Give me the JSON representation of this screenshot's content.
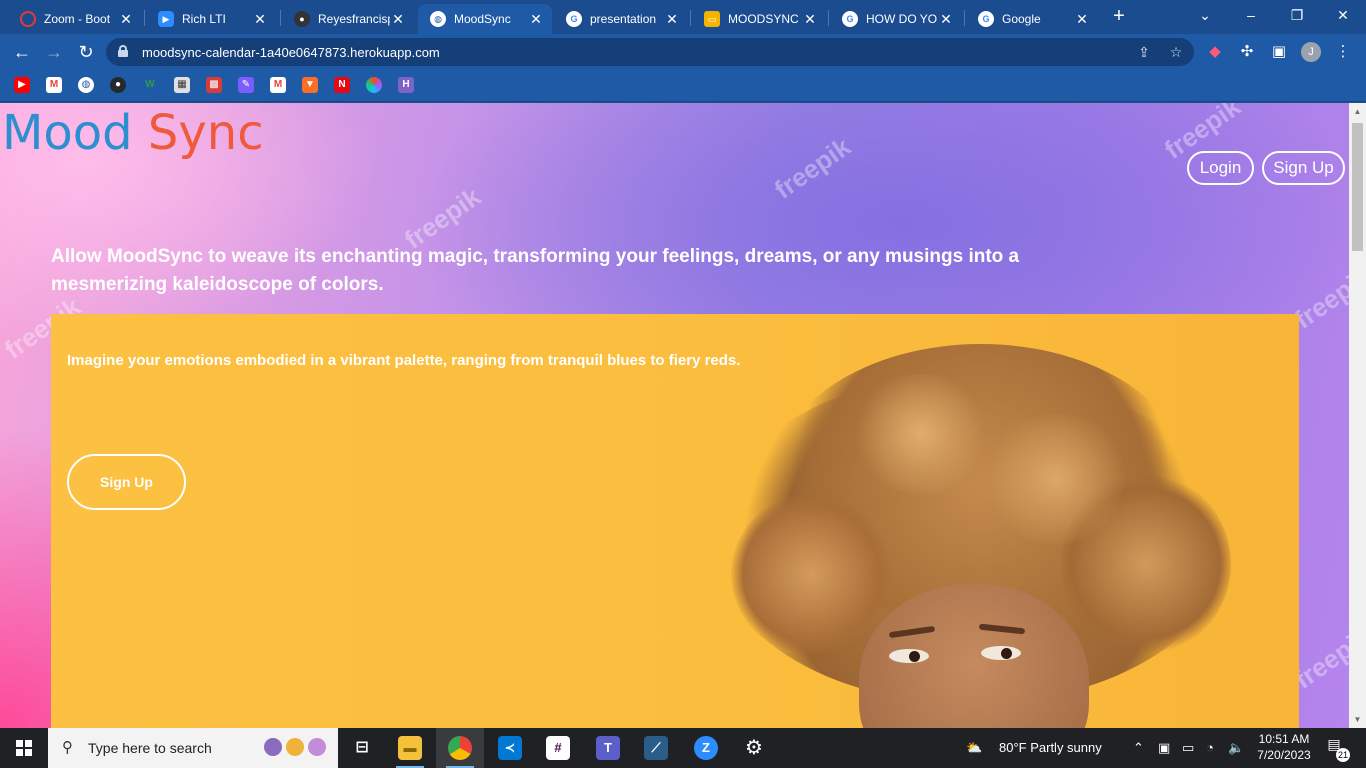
{
  "browser": {
    "tabs": [
      {
        "title": "Zoom - Boot",
        "favicon": "zoom-ring-icon",
        "color": "#e53935"
      },
      {
        "title": "Rich LTI",
        "favicon": "zoom-icon",
        "color": "#2d8cff"
      },
      {
        "title": "Reyesfrancisp",
        "favicon": "github-icon",
        "color": "#24292e"
      },
      {
        "title": "MoodSync",
        "favicon": "globe-icon",
        "color": "#ffffff"
      },
      {
        "title": "presentation",
        "favicon": "google-icon",
        "color": "#ffffff"
      },
      {
        "title": "MOODSYNC",
        "favicon": "slides-icon",
        "color": "#f4b400"
      },
      {
        "title": "HOW DO YO",
        "favicon": "google-icon",
        "color": "#ffffff"
      },
      {
        "title": "Google",
        "favicon": "google-icon",
        "color": "#ffffff"
      }
    ],
    "url": "moodsync-calendar-1a40e0647873.herokuapp.com",
    "profile_initial": "J",
    "bookmarks": [
      {
        "icon": "youtube-icon",
        "color": "#ff0000"
      },
      {
        "icon": "gmail-icon",
        "color": "#ea4335"
      },
      {
        "icon": "globe-icon",
        "color": "#ffffff"
      },
      {
        "icon": "github-icon",
        "color": "#24292e"
      },
      {
        "icon": "w-icon",
        "color": "#2e9d4a"
      },
      {
        "icon": "calculator-icon",
        "color": "#e0e0e0"
      },
      {
        "icon": "maze-icon",
        "color": "#d83b3b"
      },
      {
        "icon": "app-icon",
        "color": "#7b5cff"
      },
      {
        "icon": "gmail-icon",
        "color": "#ea4335"
      },
      {
        "icon": "gitlab-icon",
        "color": "#fc6d26"
      },
      {
        "icon": "netlify-icon",
        "color": "#e50914"
      },
      {
        "icon": "swirl-icon",
        "color": "#f24e1e"
      },
      {
        "icon": "heroku-icon",
        "color": "#7e62c6"
      }
    ]
  },
  "page": {
    "logo_word1": "Mood",
    "logo_word2": "Sync",
    "nav": {
      "login": "Login",
      "signup": "Sign Up"
    },
    "headline": "Allow MoodSync to weave its enchanting magic, transforming your feelings, dreams, or any musings into a mesmerizing kaleidoscope of colors.",
    "hero": {
      "text": "Imagine your emotions embodied in a vibrant palette, ranging from tranquil blues to fiery reds.",
      "cta": "Sign Up"
    },
    "watermark": "freepik"
  },
  "taskbar": {
    "search_placeholder": "Type here to search",
    "weather": "80°F  Partly sunny",
    "time": "10:51 AM",
    "date": "7/20/2023",
    "notification_count": "21"
  }
}
